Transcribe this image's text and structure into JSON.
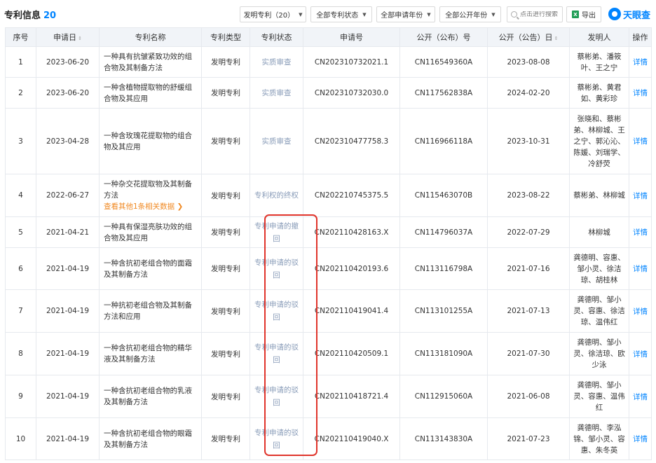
{
  "header": {
    "title": "专利信息",
    "count": "20"
  },
  "filters": [
    {
      "label": "发明专利（20）"
    },
    {
      "label": "全部专利状态"
    },
    {
      "label": "全部申请年份"
    },
    {
      "label": "全部公开年份"
    }
  ],
  "search": {
    "placeholder": "点击进行搜索"
  },
  "export": {
    "label": "导出"
  },
  "logo": {
    "text": "天眼查"
  },
  "table": {
    "columns": [
      "序号",
      "申请日",
      "专利名称",
      "专利类型",
      "专利状态",
      "申请号",
      "公开（公布）号",
      "公开（公告）日",
      "发明人",
      "操作"
    ],
    "rows": [
      {
        "idx": "1",
        "date": "2023-06-20",
        "name": "一种具有抗皱紧致功效的组合物及其制备方法",
        "type": "发明专利",
        "status": "实质审查",
        "app_no": "CN202310732021.1",
        "pub_no": "CN116549360A",
        "pub_date": "2023-08-08",
        "inventors": "蔡彬弟、潘筱叶、王之宁",
        "op": "详情"
      },
      {
        "idx": "2",
        "date": "2023-06-20",
        "name": "一种含植物提取物的舒缓组合物及其应用",
        "type": "发明专利",
        "status": "实质审查",
        "app_no": "CN202310732030.0",
        "pub_no": "CN117562838A",
        "pub_date": "2024-02-20",
        "inventors": "蔡彬弟、黄君如、黄彩珍",
        "op": "详情"
      },
      {
        "idx": "3",
        "date": "2023-04-28",
        "name": "一种含玫瑰花提取物的组合物及其应用",
        "type": "发明专利",
        "status": "实质审查",
        "app_no": "CN202310477758.3",
        "pub_no": "CN116966118A",
        "pub_date": "2023-10-31",
        "inventors": "张晓和、蔡彬弟、林柳城、王之宁、郭沁沁、陈媛、刘瑞学、冷舒荧",
        "op": "详情"
      },
      {
        "idx": "4",
        "date": "2022-06-27",
        "name": "一种杂交花提取物及其制备方法",
        "more": "查看其他1条相关数据 ❯",
        "type": "发明专利",
        "status": "专利权的终权",
        "app_no": "CN202210745375.5",
        "pub_no": "CN115463070B",
        "pub_date": "2023-08-22",
        "inventors": "蔡彬弟、林柳城",
        "op": "详情"
      },
      {
        "idx": "5",
        "date": "2021-04-21",
        "name": "一种具有保湿亮肤功效的组合物及其应用",
        "type": "发明专利",
        "status": "专利申请的撤回",
        "app_no": "CN202110428163.X",
        "pub_no": "CN114796037A",
        "pub_date": "2022-07-29",
        "inventors": "林柳城",
        "op": "详情"
      },
      {
        "idx": "6",
        "date": "2021-04-19",
        "name": "一种含抗初老组合物的面霜及其制备方法",
        "type": "发明专利",
        "status": "专利申请的驳回",
        "app_no": "CN202110420193.6",
        "pub_no": "CN113116798A",
        "pub_date": "2021-07-16",
        "inventors": "龚德明、容惠、邹小灵、徐洁琼、胡桂林",
        "op": "详情"
      },
      {
        "idx": "7",
        "date": "2021-04-19",
        "name": "一种抗初老组合物及其制备方法和应用",
        "type": "发明专利",
        "status": "专利申请的驳回",
        "app_no": "CN202110419041.4",
        "pub_no": "CN113101255A",
        "pub_date": "2021-07-13",
        "inventors": "龚德明、邹小灵、容惠、徐洁琼、温伟红",
        "op": "详情"
      },
      {
        "idx": "8",
        "date": "2021-04-19",
        "name": "一种含抗初老组合物的精华液及其制备方法",
        "type": "发明专利",
        "status": "专利申请的驳回",
        "app_no": "CN202110420509.1",
        "pub_no": "CN113181090A",
        "pub_date": "2021-07-30",
        "inventors": "龚德明、邹小灵、徐洁琼、欧少泳",
        "op": "详情"
      },
      {
        "idx": "9",
        "date": "2021-04-19",
        "name": "一种含抗初老组合物的乳液及其制备方法",
        "type": "发明专利",
        "status": "专利申请的驳回",
        "app_no": "CN202110418721.4",
        "pub_no": "CN112915060A",
        "pub_date": "2021-06-08",
        "inventors": "龚德明、邹小灵、容惠、温伟红",
        "op": "详情"
      },
      {
        "idx": "10",
        "date": "2021-04-19",
        "name": "一种含抗初老组合物的眼霜及其制备方法",
        "type": "发明专利",
        "status": "专利申请的驳回",
        "app_no": "CN202110419040.X",
        "pub_no": "CN113143830A",
        "pub_date": "2021-07-23",
        "inventors": "龚德明、李泓锦、邹小灵、容惠、朱冬英",
        "op": "详情"
      }
    ]
  },
  "colors": {
    "accent": "#0084ff",
    "status_text": "#8a9db9",
    "highlight": "#e0342b",
    "link_orange": "#f08a24",
    "header_bg": "#f1f4f8"
  }
}
